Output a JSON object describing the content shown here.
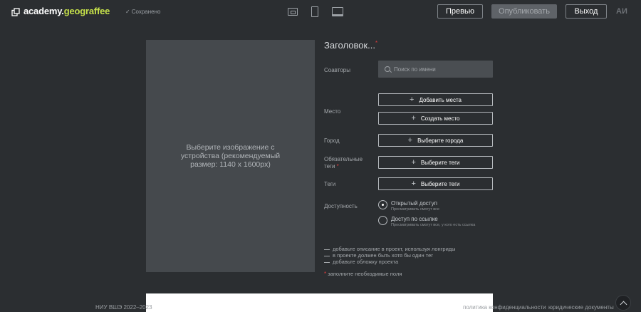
{
  "header": {
    "logo_main": "academy.",
    "logo_accent": "geograffee",
    "saved_status": "Сохранено",
    "preview_label": "Превью",
    "publish_label": "Опубликовать",
    "exit_label": "Выход",
    "avatar_initials": "АИ"
  },
  "image_upload": {
    "prompt": "Выберите изображение с устройства (рекомендуемый размер: 1140 x 1600px)"
  },
  "form": {
    "title_placeholder": "Заголовок...",
    "required_mark": "*",
    "coauthors_label": "Соавторы",
    "coauthors_search_placeholder": "Поиск по имени",
    "place_label": "Место",
    "add_places_label": "Добавить места",
    "create_place_label": "Создать место",
    "city_label": "Город",
    "choose_city_label": "Выберите города",
    "required_tags_label_line1": "Обязательные",
    "required_tags_label_line2": "теги",
    "choose_tags_label": "Выберите теги",
    "tags_label": "Теги",
    "access_label": "Доступность",
    "access_options": [
      {
        "title": "Открытый доступ",
        "subtitle": "Просматривать смогут все",
        "checked": true
      },
      {
        "title": "Доступ по ссылке",
        "subtitle": "Просматривать смогут все, у кого есть ссылка",
        "checked": false
      }
    ],
    "hints": [
      "добавьте описание в проект, используя лонгриды",
      "в проекте должен быть хотя бы один тег",
      "добавьте обложку проекта"
    ],
    "required_note": "заполните необходимые поля"
  },
  "footer": {
    "copyright": "НИУ ВШЭ 2022–2023",
    "privacy_link": "политика конфиденциальности",
    "legal_link": "юридические документы"
  }
}
